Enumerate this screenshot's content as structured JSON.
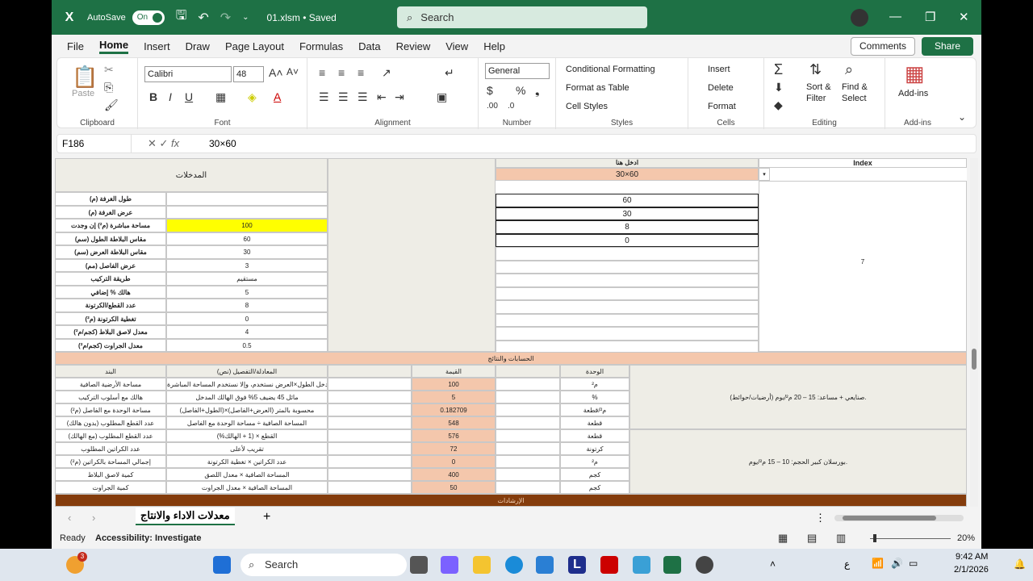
{
  "titlebar": {
    "autosave_label": "AutoSave",
    "autosave_state": "On",
    "filename": "01.xlsm • Saved",
    "search_placeholder": "Search"
  },
  "menu": {
    "tabs": [
      "File",
      "Home",
      "Insert",
      "Draw",
      "Page Layout",
      "Formulas",
      "Data",
      "Review",
      "View",
      "Help"
    ],
    "active": "Home",
    "comments": "Comments",
    "share": "Share"
  },
  "ribbon": {
    "clipboard": {
      "label": "Clipboard",
      "paste": "Paste"
    },
    "font": {
      "label": "Font",
      "font_name": "Calibri",
      "font_size": "48"
    },
    "alignment": {
      "label": "Alignment"
    },
    "number": {
      "label": "Number",
      "format": "General"
    },
    "styles": {
      "label": "Styles",
      "conditional": "Conditional Formatting",
      "table": "Format as Table",
      "cell_styles": "Cell Styles"
    },
    "cells": {
      "label": "Cells",
      "insert": "Insert",
      "delete": "Delete",
      "format": "Format"
    },
    "editing": {
      "label": "Editing",
      "sort": "Sort &",
      "filter": "Filter",
      "find": "Find &",
      "select": "Select"
    },
    "addins": {
      "label": "Add-ins",
      "button": "Add-ins"
    }
  },
  "formula_bar": {
    "cell_ref": "F186",
    "value": "30×60"
  },
  "sheet": {
    "inputs_title": "المدخلات",
    "enter_here": "ادخل هنا",
    "index_label": "Index",
    "selected_value": "30×60",
    "input_rows": [
      {
        "label": "طول الغرفة (م)",
        "value": ""
      },
      {
        "label": "عرض الغرفة (م)",
        "value": ""
      },
      {
        "label": "مساحة مباشرة (م²) إن وجدت",
        "value": "100"
      },
      {
        "label": "مقاس البلاطة الطول (سم)",
        "value": "60"
      },
      {
        "label": "مقاس البلاطة العرض (سم)",
        "value": "30"
      },
      {
        "label": "عرض الفاصل (مم)",
        "value": "3"
      },
      {
        "label": "طريقة التركيب",
        "value": "مستقيم"
      },
      {
        "label": "هالك % إضافي",
        "value": "5"
      },
      {
        "label": "عدد القطع/الكرتونة",
        "value": "8"
      },
      {
        "label": "تغطية الكرتونة (م²)",
        "value": "0"
      },
      {
        "label": "معدل لاصق البلاط (كجم/م²)",
        "value": "4"
      },
      {
        "label": "معدل الجراوت (كجم/م²)",
        "value": "0.5"
      }
    ],
    "right_values": [
      "60",
      "30",
      "8",
      "0"
    ],
    "index_value": "7",
    "calc_header": "الحسابات والنتائج",
    "table_headers": {
      "item": "البند",
      "formula": "المعادلة/التفصيل (نص)",
      "value": "القيمة",
      "unit": "الوحدة"
    },
    "calc_rows": [
      {
        "item": "مساحة الأرضية الصافية",
        "formula": "إذا أُدخل الطول×العرض نستخدم، وإلا نستخدم المساحة المباشرة",
        "value": "100",
        "unit": "م²"
      },
      {
        "item": "هالك مع أسلوب التركيب",
        "formula": "مائل 45 يضيف 5% فوق الهالك المدخل",
        "value": "5",
        "unit": "%"
      },
      {
        "item": "مساحة الوحدة مع الفاصل (م²)",
        "formula": "(الطول+الفاصل)×(العرض+الفاصل) محسوبة بالمتر",
        "value": "0.182709",
        "unit": "م²/قطعة"
      },
      {
        "item": "عدد القطع المطلوب (بدون هالك)",
        "formula": "المساحة الصافية ÷ مساحة الوحدة مع الفاصل",
        "value": "548",
        "unit": "قطعة"
      },
      {
        "item": "عدد القطع المطلوب (مع الهالك)",
        "formula": "القطع × (1 + الهالك%)",
        "value": "576",
        "unit": "قطعة"
      },
      {
        "item": "عدد الكراتين المطلوب",
        "formula": "تقريب لأعلى",
        "value": "72",
        "unit": "كرتونة"
      },
      {
        "item": "إجمالي المساحة بالكراتين (م²)",
        "formula": "عدد الكراتين × تغطية الكرتونة",
        "value": "0",
        "unit": "م²"
      },
      {
        "item": "كمية لاصق البلاط",
        "formula": "المساحة الصافية × معدل اللصق",
        "value": "400",
        "unit": "كجم"
      },
      {
        "item": "كمية الجراوت",
        "formula": "المساحة الصافية × معدل الجراوت",
        "value": "50",
        "unit": "كجم"
      }
    ],
    "note_1": "صنايعي + مساعد: 15 – 20 م²/يوم (أرضيات/حوائط).",
    "note_2": "بورسلان كبير الحجم: 10 – 15 م²/يوم.",
    "bottom_band": "الإرشادات"
  },
  "sheet_tab": "معدلات الاداء والانتاج",
  "status": {
    "ready": "Ready",
    "accessibility": "Accessibility: Investigate",
    "zoom": "20%"
  },
  "taskbar": {
    "search": "Search",
    "time": "9:42 AM",
    "date": "2/1/2026",
    "lang": "ع",
    "badge": "3"
  }
}
